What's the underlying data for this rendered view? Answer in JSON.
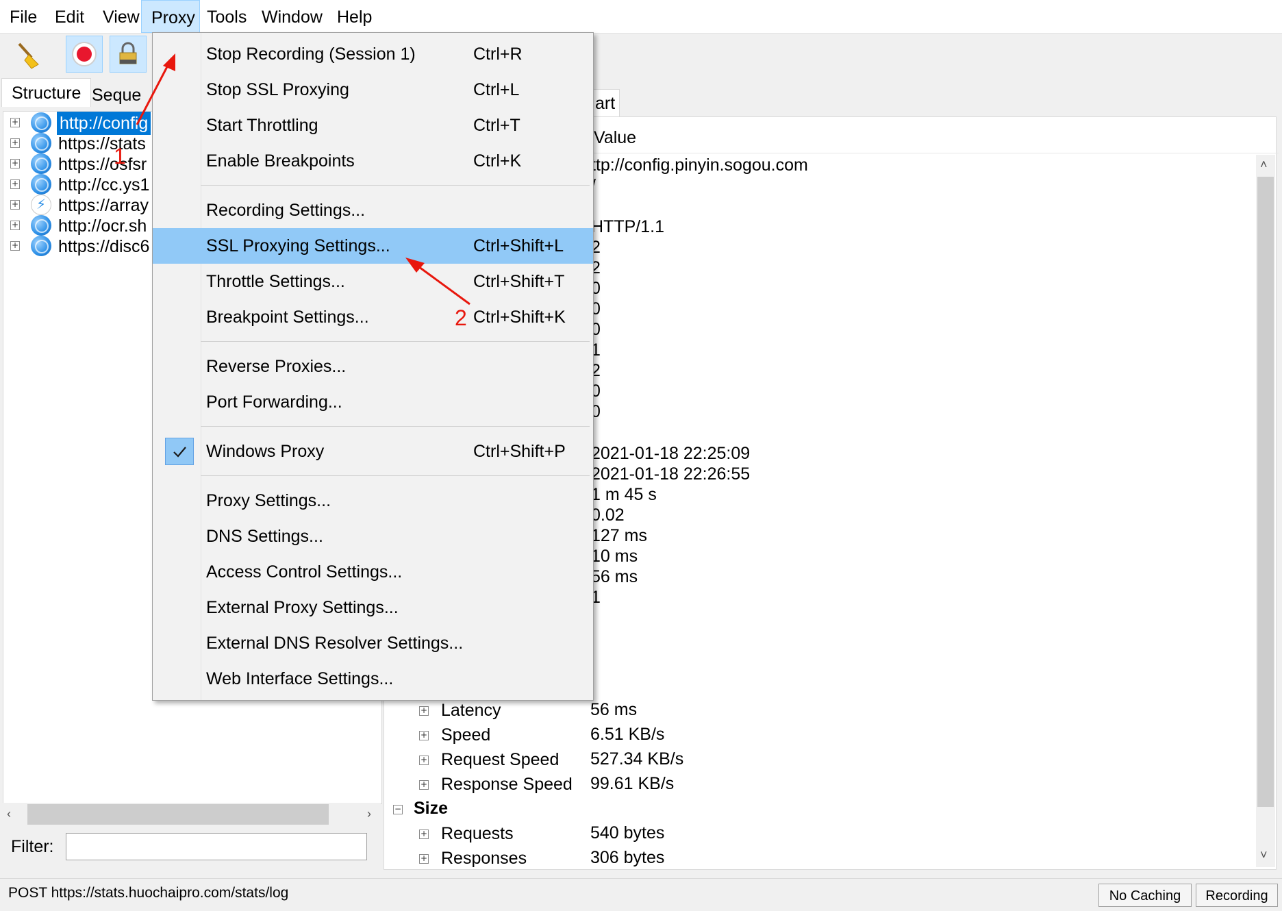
{
  "menubar": {
    "items": [
      "File",
      "Edit",
      "View",
      "Proxy",
      "Tools",
      "Window",
      "Help"
    ],
    "active": "Proxy"
  },
  "toolbar": {
    "icons": [
      "broom-icon",
      "record-icon",
      "lock-icon"
    ]
  },
  "left_panel": {
    "tabs": [
      "Structure",
      "Seque"
    ],
    "tree": [
      {
        "label": "http://config",
        "icon": "globe-icon",
        "selected": true
      },
      {
        "label": "https://stats",
        "icon": "globe-icon"
      },
      {
        "label": "https://osfsr",
        "icon": "globe-icon"
      },
      {
        "label": "http://cc.ys1",
        "icon": "globe-icon"
      },
      {
        "label": "https://array",
        "icon": "bolt-icon"
      },
      {
        "label": "http://ocr.sh",
        "icon": "globe-icon"
      },
      {
        "label": "https://disc6",
        "icon": "globe-icon"
      }
    ],
    "filter_label": "Filter:",
    "filter_value": ""
  },
  "right_panel": {
    "tab_fragment": "art",
    "value_header": "Value",
    "partial_values": [
      "ttp://config.pinyin.sogou.com",
      "/",
      "HTTP/1.1",
      "2",
      "2",
      "0",
      "0",
      "0",
      "1",
      "2",
      "0",
      "0",
      "2021-01-18 22:25:09",
      "2021-01-18 22:26:55",
      "1 m 45 s",
      "0.02",
      "127 ms",
      "10 ms",
      "56 ms",
      "1"
    ],
    "rows": [
      {
        "expander": "+",
        "name": "Latency",
        "value": "56 ms"
      },
      {
        "expander": "+",
        "name": "Speed",
        "value": "6.51 KB/s"
      },
      {
        "expander": "+",
        "name": "Request Speed",
        "value": "527.34 KB/s"
      },
      {
        "expander": "+",
        "name": "Response Speed",
        "value": "99.61 KB/s"
      },
      {
        "expander": "-",
        "name": "Size",
        "value": "",
        "bold": true
      },
      {
        "expander": "+",
        "name": "Requests",
        "value": "540 bytes"
      },
      {
        "expander": "+",
        "name": "Responses",
        "value": "306 bytes"
      }
    ]
  },
  "status_bar": {
    "text": "POST https://stats.huochaipro.com/stats/log",
    "buttons": [
      "No Caching",
      "Recording"
    ]
  },
  "proxy_menu": {
    "groups": [
      [
        {
          "label": "Stop Recording (Session 1)",
          "shortcut": "Ctrl+R"
        },
        {
          "label": "Stop SSL Proxying",
          "shortcut": "Ctrl+L"
        },
        {
          "label": "Start Throttling",
          "shortcut": "Ctrl+T"
        },
        {
          "label": "Enable Breakpoints",
          "shortcut": "Ctrl+K"
        }
      ],
      [
        {
          "label": "Recording Settings...",
          "shortcut": ""
        },
        {
          "label": "SSL Proxying Settings...",
          "shortcut": "Ctrl+Shift+L",
          "highlighted": true
        },
        {
          "label": "Throttle Settings...",
          "shortcut": "Ctrl+Shift+T"
        },
        {
          "label": "Breakpoint Settings...",
          "shortcut": "Ctrl+Shift+K"
        }
      ],
      [
        {
          "label": "Reverse Proxies...",
          "shortcut": ""
        },
        {
          "label": "Port Forwarding...",
          "shortcut": ""
        }
      ],
      [
        {
          "label": "Windows Proxy",
          "shortcut": "Ctrl+Shift+P",
          "checked": true
        }
      ],
      [
        {
          "label": "Proxy Settings...",
          "shortcut": ""
        },
        {
          "label": "DNS Settings...",
          "shortcut": ""
        },
        {
          "label": "Access Control Settings...",
          "shortcut": ""
        },
        {
          "label": "External Proxy Settings...",
          "shortcut": ""
        },
        {
          "label": "External DNS Resolver Settings...",
          "shortcut": ""
        },
        {
          "label": "Web Interface Settings...",
          "shortcut": ""
        }
      ]
    ]
  },
  "annotations": {
    "marker_1": "1",
    "marker_2": "2",
    "color": "#e8170d"
  }
}
